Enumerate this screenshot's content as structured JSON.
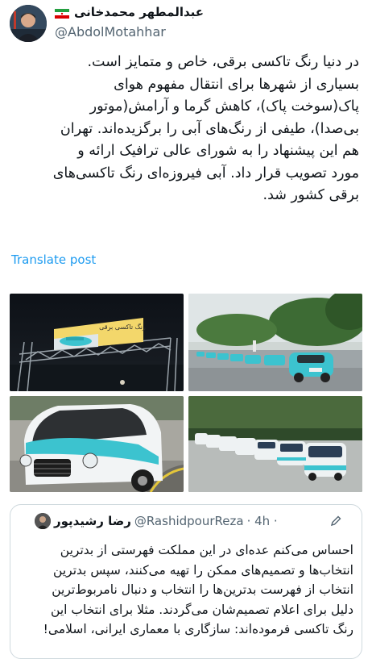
{
  "author": {
    "display_name": "عبدالمطهر محمدخانی",
    "handle": "@AbdolMotahhar",
    "flag": "iran-flag-icon"
  },
  "tweet": {
    "lines": [
      "در دنیا رنگ تاکسی برقی، خاص و متمایز است.",
      "بسیاری از شهرها برای انتقال مفهوم هوای",
      "پاک(سوخت پاک)، کاهش گرما و آرامش(موتور",
      "بی‌صدا)، طیفی از رنگ‌های آبی را برگزیده‌اند. تهران",
      "هم این پیشنهاد را به شورای عالی ترافیک ارائه و",
      "مورد تصویب قرار داد. آبی فیروزه‌ای رنگ تاکسی‌های",
      "برقی کشور شد."
    ],
    "translate_label": "Translate post"
  },
  "media": {
    "billboard_text": "رنگ تاکسی برقی"
  },
  "quote": {
    "display_name": "رضا رشیدپور",
    "handle": "@RashidpourReza",
    "time": "· 4h ·",
    "icon": "pencil-icon",
    "lines": [
      "احساس می‌کنم عده‌ای در این مملکت فهرستی از بدترین",
      "انتخاب‌ها و تصمیم‌های ممکن را تهیه می‌کنند، سپس بدترین",
      "انتخاب از فهرست بدترین‌ها را انتخاب و دنبال نامربوط‌ترین",
      "دلیل برای اعلام تصمیم‌شان می‌گردند. مثلا برای انتخاب این",
      "رنگ تاکسی فرموده‌اند: سازگاری با معماری  ایرانی، اسلامی!"
    ]
  },
  "colors": {
    "link": "#1d9bf0",
    "secondary_text": "#536471",
    "taxi_turquoise": "#3cc3cf"
  }
}
